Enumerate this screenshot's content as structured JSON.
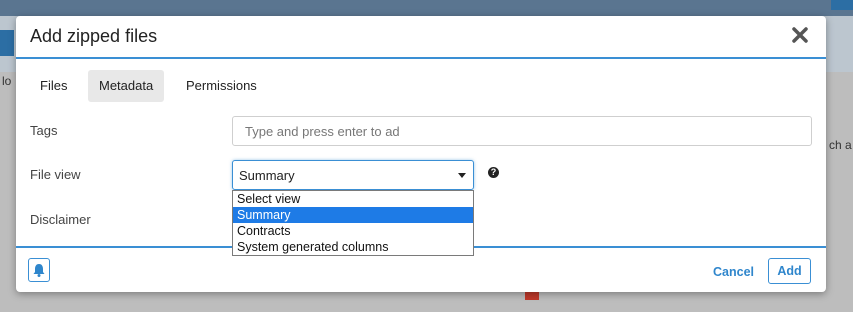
{
  "modal": {
    "title": "Add zipped files",
    "tabs": [
      {
        "label": "Files",
        "active": false
      },
      {
        "label": "Metadata",
        "active": true
      },
      {
        "label": "Permissions",
        "active": false
      }
    ],
    "fields": {
      "tags": {
        "label": "Tags",
        "placeholder": "Type and press enter to ad",
        "value": ""
      },
      "file_view": {
        "label": "File view",
        "selected": "Summary",
        "options": [
          "Select view",
          "Summary",
          "Contracts",
          "System generated columns"
        ],
        "selected_index": 1
      },
      "disclaimer": {
        "label": "Disclaimer"
      }
    },
    "footer": {
      "cancel_label": "Cancel",
      "add_label": "Add"
    }
  },
  "background": {
    "left_text": "lo",
    "right_text": "ch a"
  },
  "colors": {
    "accent": "#3a8fd4",
    "link": "#2f86cc",
    "selected_option": "#1e7be6"
  },
  "icons": {
    "close": "close-icon",
    "help": "help-icon",
    "notify": "bell-icon",
    "caret": "chevron-down-icon"
  }
}
